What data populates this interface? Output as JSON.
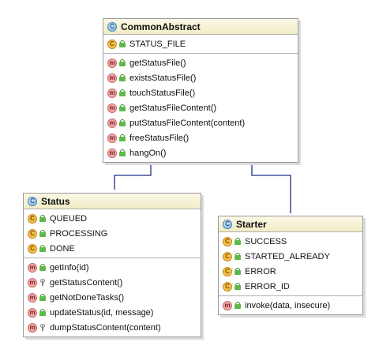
{
  "classes": {
    "common": {
      "name": "CommonAbstract",
      "fields": [
        "STATUS_FILE"
      ],
      "methods": [
        "getStatusFile()",
        "existsStatusFile()",
        "touchStatusFile()",
        "getStatusFileContent()",
        "putStatusFileContent(content)",
        "freeStatusFile()",
        "hangOn()"
      ]
    },
    "status": {
      "name": "Status",
      "fields": [
        "QUEUED",
        "PROCESSING",
        "DONE"
      ],
      "methods": [
        "getInfo(id)",
        "getStatusContent()",
        "getNotDoneTasks()",
        "updateStatus(id, message)",
        "dumpStatusContent(content)"
      ]
    },
    "starter": {
      "name": "Starter",
      "fields": [
        "SUCCESS",
        "STARTED_ALREADY",
        "ERROR",
        "ERROR_ID"
      ],
      "methods": [
        "invoke(data, insecure)"
      ]
    }
  },
  "icons": {
    "class": "C",
    "field": "C",
    "method": "m"
  },
  "colors": {
    "arrow": "#1f2f8a",
    "header": "#f3efcf",
    "border": "#9a9a9a"
  }
}
